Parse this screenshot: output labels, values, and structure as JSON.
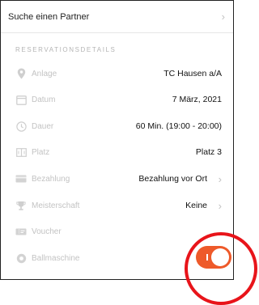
{
  "partner": {
    "label": "Suche einen Partner"
  },
  "section": {
    "title": "RESERVATIONSDETAILS"
  },
  "details": {
    "anlage": {
      "label": "Anlage",
      "value": "TC Hausen a/A",
      "icon": "location-pin-icon"
    },
    "datum": {
      "label": "Datum",
      "value": "7 März, 2021",
      "icon": "calendar-icon"
    },
    "dauer": {
      "label": "Dauer",
      "value": "60 Min. (19:00 - 20:00)",
      "icon": "clock-icon"
    },
    "platz": {
      "label": "Platz",
      "value": "Platz 3",
      "icon": "court-icon"
    },
    "bezahlung": {
      "label": "Bezahlung",
      "value": "Bezahlung vor Ort",
      "icon": "credit-card-icon"
    },
    "meisterschaft": {
      "label": "Meisterschaft",
      "value": "Keine",
      "icon": "trophy-icon"
    },
    "voucher": {
      "label": "Voucher",
      "icon": "voucher-icon"
    },
    "ballmaschine": {
      "label": "Ballmaschine",
      "icon": "ball-machine-icon",
      "enabled": true
    }
  },
  "colors": {
    "accent": "#ee5a2a",
    "annotation": "#e8141a",
    "label_gray": "#c3c3c3"
  }
}
